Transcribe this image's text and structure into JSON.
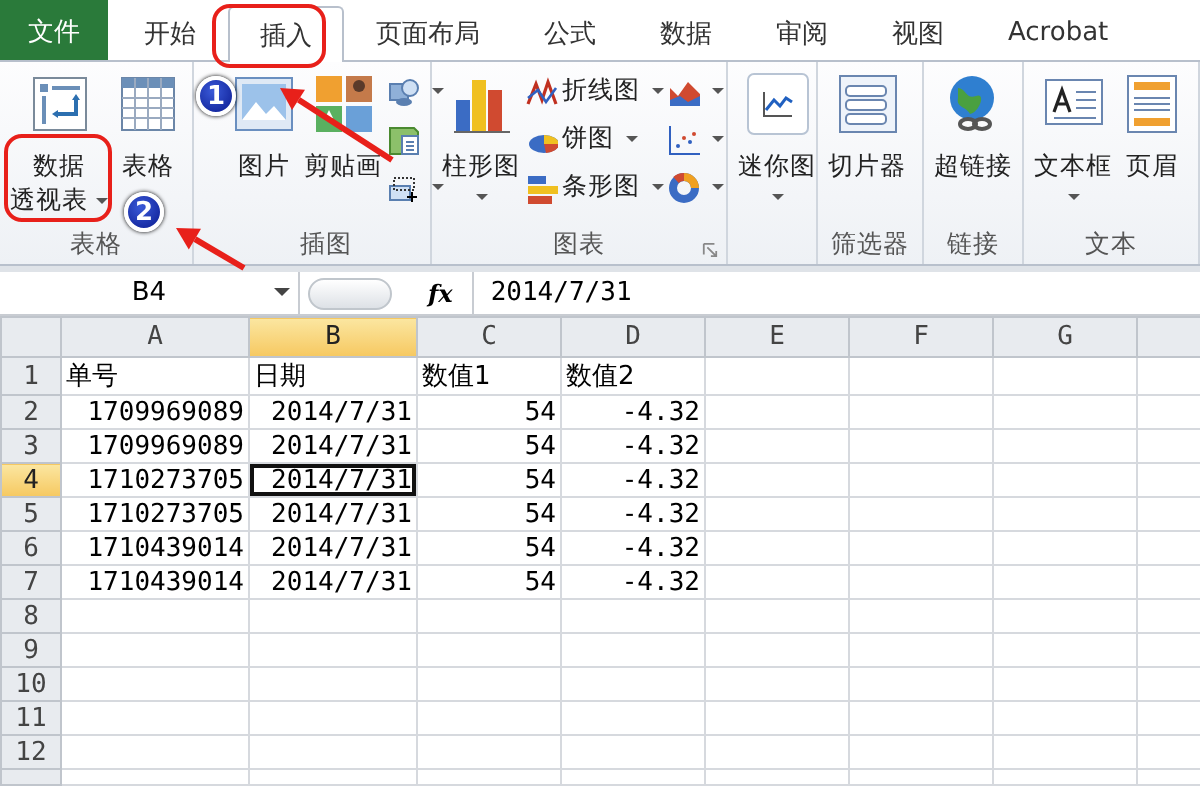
{
  "tabs": [
    {
      "label": "文件",
      "kind": "file",
      "selected": false
    },
    {
      "label": "开始",
      "kind": "tab",
      "selected": false
    },
    {
      "label": "插入",
      "kind": "tab",
      "selected": true
    },
    {
      "label": "页面布局",
      "kind": "tab",
      "selected": false
    },
    {
      "label": "公式",
      "kind": "tab",
      "selected": false
    },
    {
      "label": "数据",
      "kind": "tab",
      "selected": false
    },
    {
      "label": "审阅",
      "kind": "tab",
      "selected": false
    },
    {
      "label": "视图",
      "kind": "tab",
      "selected": false
    },
    {
      "label": "Acrobat",
      "kind": "tab",
      "selected": false
    }
  ],
  "ribbon_groups": [
    {
      "label": "表格",
      "items": [
        {
          "label_lines": [
            "数据",
            "透视表"
          ],
          "kind": "large",
          "dropdown": true
        },
        {
          "label_lines": [
            "表格"
          ],
          "kind": "large"
        }
      ]
    },
    {
      "label": "插图",
      "items": [
        {
          "label_lines": [
            "图片"
          ],
          "kind": "large"
        },
        {
          "label_lines": [
            "剪贴画"
          ],
          "kind": "large"
        },
        {
          "kind": "icon",
          "dropdown": true
        },
        {
          "kind": "icon"
        },
        {
          "kind": "icon",
          "dropdown": true
        }
      ]
    },
    {
      "label": "图表",
      "launcher": true,
      "items": [
        {
          "label_lines": [
            "柱形图"
          ],
          "kind": "large",
          "dropdown": true
        },
        {
          "label_lines": [
            "折线图"
          ],
          "kind": "small",
          "dropdown": true
        },
        {
          "label_lines": [
            "饼图"
          ],
          "kind": "small",
          "dropdown": true
        },
        {
          "label_lines": [
            "条形图"
          ],
          "kind": "small",
          "dropdown": true
        },
        {
          "kind": "icon",
          "dropdown": true
        },
        {
          "kind": "icon",
          "dropdown": true
        },
        {
          "kind": "icon",
          "dropdown": true
        }
      ]
    },
    {
      "items": [
        {
          "label_lines": [
            "迷你图"
          ],
          "kind": "large",
          "dropdown": true
        }
      ]
    },
    {
      "label": "筛选器",
      "items": [
        {
          "label_lines": [
            "切片器"
          ],
          "kind": "large"
        }
      ]
    },
    {
      "label": "链接",
      "items": [
        {
          "label_lines": [
            "超链接"
          ],
          "kind": "large"
        }
      ]
    },
    {
      "label": "文本",
      "items": [
        {
          "label_lines": [
            "文本框"
          ],
          "kind": "large",
          "dropdown": true
        },
        {
          "label_lines": [
            "页眉"
          ],
          "kind": "large"
        }
      ]
    }
  ],
  "formula_bar": {
    "name_box": "B4",
    "function_label": "fx",
    "value": "2014/7/31"
  },
  "sheet": {
    "columns": [
      {
        "label": "A",
        "selected": false
      },
      {
        "label": "B",
        "selected": true
      },
      {
        "label": "C",
        "selected": false
      },
      {
        "label": "D",
        "selected": false
      },
      {
        "label": "E",
        "selected": false
      },
      {
        "label": "F",
        "selected": false
      },
      {
        "label": "G",
        "selected": false
      }
    ],
    "rows": [
      {
        "header": "1",
        "kind": "text",
        "selected": false,
        "cells": [
          {
            "text": "单号",
            "selected": false
          },
          {
            "text": "日期",
            "selected": false
          },
          {
            "text": "数值1",
            "selected": false
          },
          {
            "text": "数值2",
            "selected": false
          }
        ]
      },
      {
        "header": "2",
        "kind": "number",
        "selected": false,
        "cells": [
          {
            "text": "1709969089",
            "selected": false
          },
          {
            "text": "2014/7/31",
            "selected": false
          },
          {
            "text": "54",
            "selected": false
          },
          {
            "text": "-4.32",
            "selected": false
          }
        ]
      },
      {
        "header": "3",
        "kind": "number",
        "selected": false,
        "cells": [
          {
            "text": "1709969089",
            "selected": false
          },
          {
            "text": "2014/7/31",
            "selected": false
          },
          {
            "text": "54",
            "selected": false
          },
          {
            "text": "-4.32",
            "selected": false
          }
        ]
      },
      {
        "header": "4",
        "kind": "number",
        "selected": true,
        "cells": [
          {
            "text": "1710273705",
            "selected": false
          },
          {
            "text": "2014/7/31",
            "selected": true
          },
          {
            "text": "54",
            "selected": false
          },
          {
            "text": "-4.32",
            "selected": false
          }
        ]
      },
      {
        "header": "5",
        "kind": "number",
        "selected": false,
        "cells": [
          {
            "text": "1710273705",
            "selected": false
          },
          {
            "text": "2014/7/31",
            "selected": false
          },
          {
            "text": "54",
            "selected": false
          },
          {
            "text": "-4.32",
            "selected": false
          }
        ]
      },
      {
        "header": "6",
        "kind": "number",
        "selected": false,
        "cells": [
          {
            "text": "1710439014",
            "selected": false
          },
          {
            "text": "2014/7/31",
            "selected": false
          },
          {
            "text": "54",
            "selected": false
          },
          {
            "text": "-4.32",
            "selected": false
          }
        ]
      },
      {
        "header": "7",
        "kind": "number",
        "selected": false,
        "cells": [
          {
            "text": "1710439014",
            "selected": false
          },
          {
            "text": "2014/7/31",
            "selected": false
          },
          {
            "text": "54",
            "selected": false
          },
          {
            "text": "-4.32",
            "selected": false
          }
        ]
      },
      {
        "header": "8",
        "selected": false
      },
      {
        "header": "9",
        "selected": false
      },
      {
        "header": "10",
        "selected": false
      },
      {
        "header": "11",
        "selected": false
      },
      {
        "header": "12",
        "selected": false
      }
    ]
  },
  "annotations": {
    "badges": [
      "1",
      "2"
    ]
  }
}
